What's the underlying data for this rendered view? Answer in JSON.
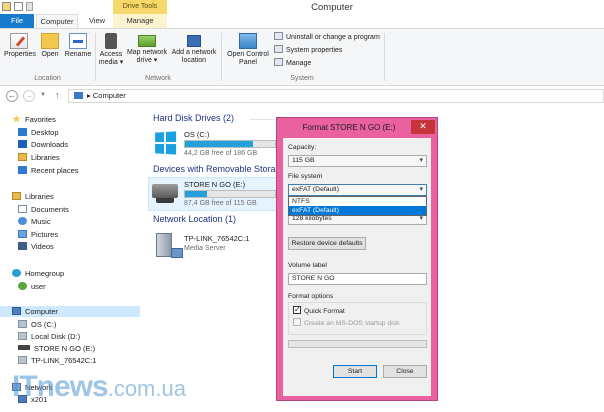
{
  "window": {
    "title": "Computer",
    "context_tab": "Drive Tools"
  },
  "ribbon": {
    "tabs": [
      "File",
      "Computer",
      "View",
      "Manage"
    ],
    "location": {
      "label": "Location",
      "properties": "Properties",
      "open": "Open",
      "rename": "Rename"
    },
    "network": {
      "label": "Network",
      "access_media_1": "Access",
      "access_media_2": "media ▾",
      "map_drive_1": "Map network",
      "map_drive_2": "drive ▾",
      "add_location_1": "Add a network",
      "add_location_2": "location"
    },
    "system": {
      "label": "System",
      "control_panel_1": "Open Control",
      "control_panel_2": "Panel",
      "uninstall": "Uninstall or change a program",
      "system_properties": "System properties",
      "manage": "Manage"
    }
  },
  "address": {
    "crumb_sep": "▸",
    "path": "Computer"
  },
  "nav": {
    "favorites": "Favorites",
    "desktop": "Desktop",
    "downloads": "Downloads",
    "libraries_fav": "Libraries",
    "recent": "Recent places",
    "libraries": "Libraries",
    "documents": "Documents",
    "music": "Music",
    "pictures": "Pictures",
    "videos": "Videos",
    "homegroup": "Homegroup",
    "user": "user",
    "computer": "Computer",
    "os_c": "OS (C:)",
    "local_d": "Local Disk (D:)",
    "store_e": "STORE N GO (E:)",
    "tplink": "TP-LINK_76542C:1",
    "network": "Network",
    "x201": "x201"
  },
  "content": {
    "hdd_section": "Hard Disk Drives (2)",
    "removable_section": "Devices with Removable Stora",
    "netloc_section": "Network Location (1)",
    "os_c": {
      "name": "OS (C:)",
      "free": "44,2 GB free of 186 GB",
      "used_fraction": 0.76
    },
    "store": {
      "name": "STORE N GO (E:)",
      "free": "87,4 GB free of 115 GB",
      "used_fraction": 0.24
    },
    "tplink": {
      "name": "TP-LINK_76542C:1",
      "type": "Media Server"
    }
  },
  "dialog": {
    "title": "Format STORE N GO (E:)",
    "close": "✕",
    "capacity_label": "Capacity:",
    "capacity_value": "115 GB",
    "fs_label": "File system",
    "fs_value": "exFAT (Default)",
    "fs_options": [
      "NTFS",
      "exFAT (Default)"
    ],
    "fs_selected_index": 1,
    "alloc_value": "128 kilobytes",
    "restore_button": "Restore device defaults",
    "volume_label": "Volume label",
    "volume_value": "STORE N GO",
    "format_options": "Format options",
    "quick_format": "Quick Format",
    "quick_checked": true,
    "msdos_disk": "Create an MS-DOS startup disk",
    "start_button": "Start",
    "close_button": "Close"
  },
  "watermark": {
    "brand": "ITnews",
    "domain": ".com.ua"
  },
  "colors": {
    "accent": "#1979ca",
    "dialog_border": "#e9619f",
    "selection": "#0078d7",
    "drive_bar": "#26a0da"
  }
}
